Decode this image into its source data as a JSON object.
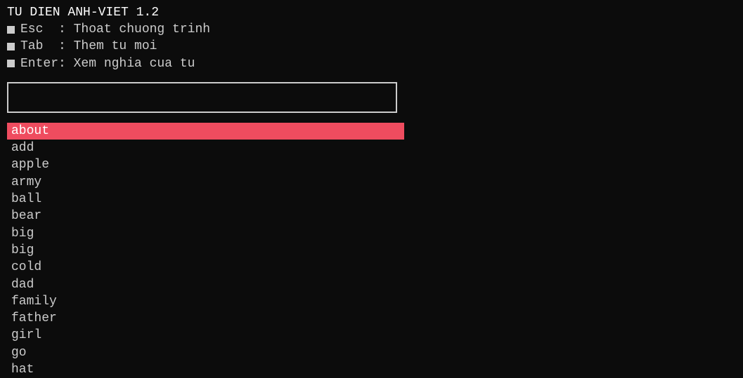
{
  "app": {
    "title": "TU DIEN ANH-VIET 1.2"
  },
  "help": {
    "esc": "Esc  : Thoat chuong trinh",
    "tab": "Tab  : Them tu moi",
    "enter": "Enter: Xem nghia cua tu"
  },
  "search": {
    "value": ""
  },
  "words": {
    "selected_index": 0,
    "items": [
      "about",
      "add",
      "apple",
      "army",
      "ball",
      "bear",
      "big",
      "big",
      "cold",
      "dad",
      "family",
      "father",
      "girl",
      "go",
      "hat"
    ]
  },
  "colors": {
    "bg": "#0c0c0c",
    "fg": "#cccccc",
    "highlight": "#ef4c5f"
  }
}
